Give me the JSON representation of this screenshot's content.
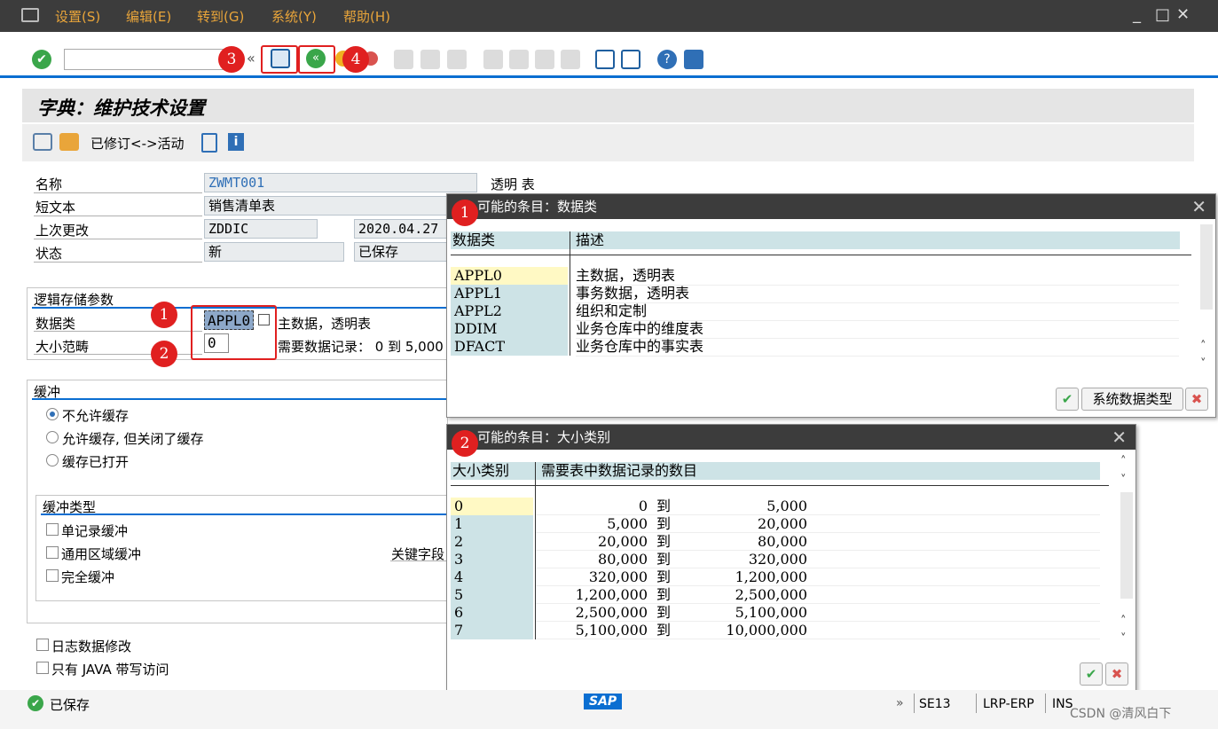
{
  "menu": [
    "设置(S)",
    "编辑(E)",
    "转到(G)",
    "系统(Y)",
    "帮助(H)"
  ],
  "window_controls": [
    "_",
    "□",
    "✕"
  ],
  "toolbar": {
    "command_placeholder": "",
    "badges": [
      "3",
      "4"
    ]
  },
  "page_title": "字典：维护技术设置",
  "app_toolbar": {
    "revision_label": "已修订<->活动"
  },
  "header_fields": {
    "name_label": "名称",
    "name_value": "ZWMT001",
    "table_type": "透明 表",
    "short_text_label": "短文本",
    "short_text_value": "销售清单表",
    "last_changed_label": "上次更改",
    "last_changed_user": "ZDDIC",
    "last_changed_date": "2020.04.27",
    "status_label": "状态",
    "status_value": "新",
    "status_saved": "已保存"
  },
  "storage": {
    "section_title": "逻辑存储参数",
    "data_class_label": "数据类",
    "data_class_value": "APPL0",
    "data_class_desc": "主数据，透明表",
    "size_label": "大小范畴",
    "size_value": "0",
    "size_desc": "需要数据记录：  0 到 5,000",
    "badges": [
      "1",
      "2"
    ]
  },
  "buffer": {
    "section_title": "缓冲",
    "options": [
      "不允许缓存",
      "允许缓存, 但关闭了缓存",
      "缓存已打开"
    ],
    "type_title": "缓冲类型",
    "types": [
      "单记录缓冲",
      "通用区域缓冲",
      "完全缓冲"
    ],
    "key_fields_label": "关键字段"
  },
  "log_changes": "日志数据修改",
  "java_only": "只有 JAVA 带写访问",
  "dialog1": {
    "badge": "1",
    "title": "可能的条目：数据类",
    "col1": "数据类",
    "col2": "描述",
    "rows": [
      {
        "k": "APPL0",
        "v": "主数据，透明表"
      },
      {
        "k": "APPL1",
        "v": "事务数据，透明表"
      },
      {
        "k": "APPL2",
        "v": "组织和定制"
      },
      {
        "k": "DDIM",
        "v": "业务仓库中的维度表"
      },
      {
        "k": "DFACT",
        "v": "业务仓库中的事实表"
      }
    ],
    "button_label": "系统数据类型"
  },
  "dialog2": {
    "badge": "2",
    "title": "可能的条目：大小类别",
    "col1": "大小类别",
    "col2": "需要表中数据记录的数目",
    "rows": [
      {
        "k": "0",
        "from": "0",
        "to": "5,000"
      },
      {
        "k": "1",
        "from": "5,000",
        "to": "20,000"
      },
      {
        "k": "2",
        "from": "20,000",
        "to": "80,000"
      },
      {
        "k": "3",
        "from": "80,000",
        "to": "320,000"
      },
      {
        "k": "4",
        "from": "320,000",
        "to": "1,200,000"
      },
      {
        "k": "5",
        "from": "1,200,000",
        "to": "2,500,000"
      },
      {
        "k": "6",
        "from": "2,500,000",
        "to": "5,100,000"
      },
      {
        "k": "7",
        "from": "5,100,000",
        "to": "10,000,000"
      }
    ],
    "to_word": "到"
  },
  "status": {
    "message": "已保存",
    "transaction": "SE13",
    "system": "LRP-ERP",
    "mode": "INS",
    "logo": "SAP",
    "watermark": "CSDN @清风白下"
  },
  "colors": {
    "menubar": "#3c3c3c",
    "menu_text": "#e9a53a",
    "accent": "#0a6ed1",
    "annotation": "#e02020",
    "row_key": "#cde3e6"
  }
}
